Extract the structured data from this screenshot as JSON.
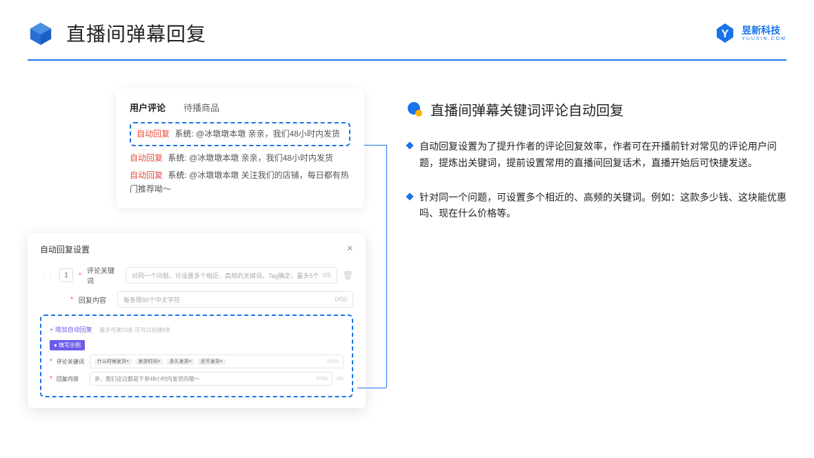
{
  "header": {
    "title": "直播间弹幕回复",
    "brand_cn": "昱新科技",
    "brand_en": "YUUXIN.COM"
  },
  "comment_panel": {
    "tabs": {
      "active": "用户评论",
      "inactive": "待播商品"
    },
    "highlighted": {
      "tag": "自动回复",
      "sys": "系统:",
      "text": "@冰墩墩本墩 亲亲，我们48小时内发货"
    },
    "lines": [
      {
        "tag": "自动回复",
        "sys": "系统:",
        "text": "@冰墩墩本墩 亲亲，我们48小时内发货"
      },
      {
        "tag": "自动回复",
        "sys": "系统:",
        "text": "@冰墩墩本墩 关注我们的店铺，每日都有热门推荐呦～"
      }
    ]
  },
  "settings": {
    "title": "自动回复设置",
    "close": "×",
    "idx": "1",
    "keyword_label": "评论关键词",
    "keyword_placeholder": "对同一个问题，可设置多个相近、高频的关键词，Tag确定，最多5个",
    "keyword_counter": "0/5",
    "content_label": "回复内容",
    "content_placeholder": "每条限50个中文字符",
    "content_counter": "0/50",
    "add_label": "+ 增加自动回复",
    "add_hint": "最多可建10条 还可以创建9条",
    "example_badge": "● 填写示例",
    "ex_keyword_label": "评论关键词",
    "ex_tags": [
      "什么时候发货×",
      "发货时间×",
      "多久发货×",
      "还不发货×"
    ],
    "ex_kw_counter": "20/50",
    "ex_content_label": "回复内容",
    "ex_content_value": "亲，我们这边都是下单48小时内发货的哦～",
    "ex_content_counter": "37/50",
    "outer_counter": "/50"
  },
  "right": {
    "section_title": "直播间弹幕关键词评论自动回复",
    "bullets": [
      "自动回复设置为了提升作者的评论回复效率，作者可在开播前针对常见的评论用户问题，提炼出关键词，提前设置常用的直播间回复话术，直播开始后可快捷发送。",
      "针对同一个问题，可设置多个相近的、高频的关键词。例如：这款多少钱、这块能优惠吗、现在什么价格等。"
    ]
  }
}
